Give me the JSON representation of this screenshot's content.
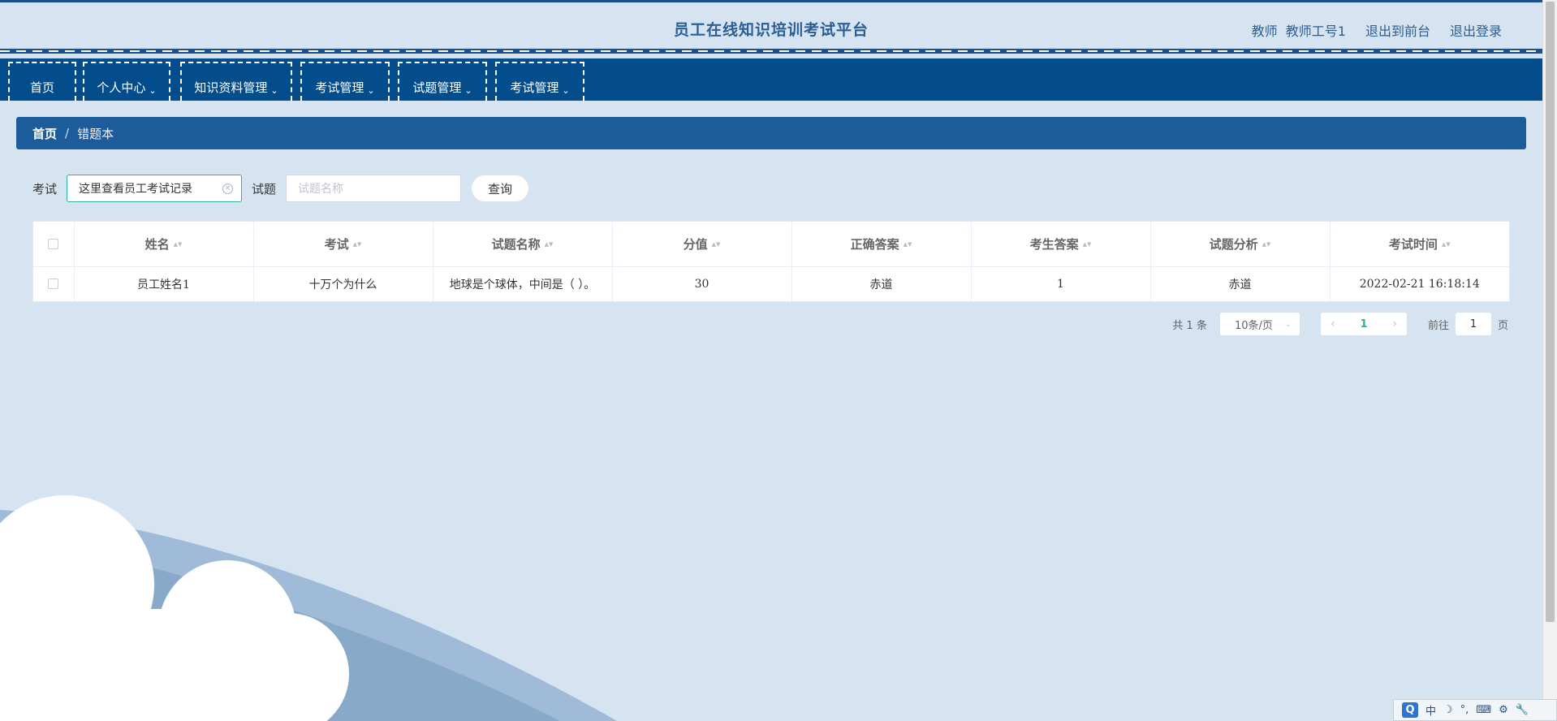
{
  "header": {
    "site_title": "员工在线知识培训考试平台",
    "role": "教师",
    "username": "教师工号1",
    "back_to_front_label": "退出到前台",
    "logout_label": "退出登录"
  },
  "nav": {
    "items": [
      {
        "label": "首页"
      },
      {
        "label": "个人中心"
      },
      {
        "label": "知识资料管理"
      },
      {
        "label": "考试管理"
      },
      {
        "label": "试题管理"
      },
      {
        "label": "考试管理"
      }
    ]
  },
  "breadcrumb": {
    "home": "首页",
    "separator": "/",
    "current": "错题本"
  },
  "search": {
    "exam_label": "考试",
    "exam_value": "这里查看员工考试记录",
    "question_label": "试题",
    "question_placeholder": "试题名称",
    "query_label": "查询"
  },
  "table": {
    "columns": [
      "姓名",
      "考试",
      "试题名称",
      "分值",
      "正确答案",
      "考生答案",
      "试题分析",
      "考试时间"
    ],
    "rows": [
      [
        "员工姓名1",
        "十万个为什么",
        "地球是个球体，中间是（ ）。",
        "30",
        "赤道",
        "1",
        "赤道",
        "2022-02-21 16:18:14"
      ]
    ]
  },
  "pagination": {
    "total_text": "共 1 条",
    "page_size": "10条/页",
    "current_page": "1",
    "goto_label": "前往",
    "goto_value": "1",
    "page_unit": "页"
  },
  "ime": {
    "lang": "中"
  },
  "colors": {
    "nav_bg": "#034d8c",
    "breadcrumb_bg": "#1c5c9b",
    "page_bg": "#d6e4f1",
    "accent": "#2bb1a0"
  }
}
